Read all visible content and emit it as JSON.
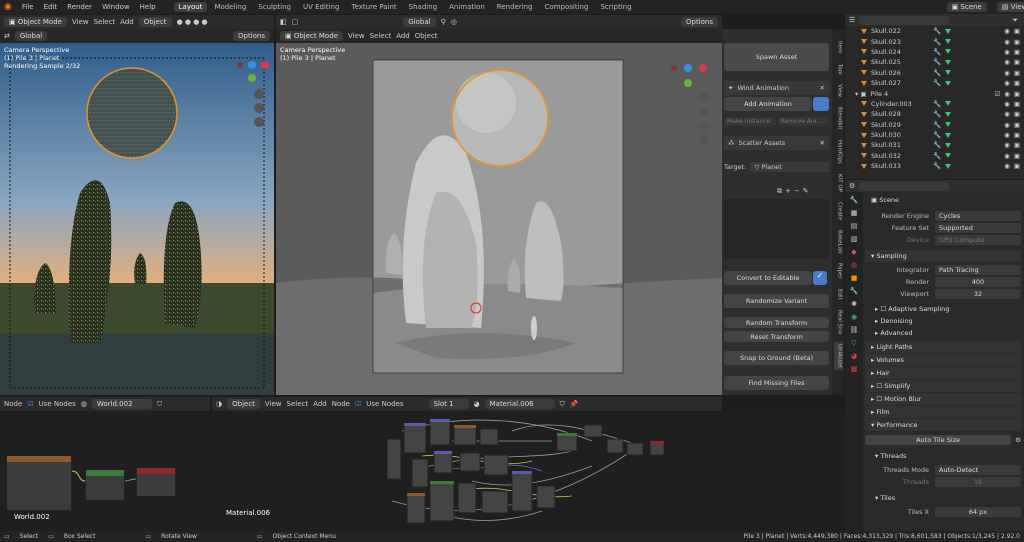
{
  "topbar": {
    "menus": [
      "File",
      "Edit",
      "Render",
      "Window",
      "Help"
    ],
    "tabs": [
      "Layout",
      "Modeling",
      "Sculpting",
      "UV Editing",
      "Texture Paint",
      "Shading",
      "Animation",
      "Rendering",
      "Compositing",
      "Scripting"
    ],
    "active_tab": "Layout",
    "scene": "Scene",
    "view_layer": "View Layer"
  },
  "left_view": {
    "mode": "Object Mode",
    "menus": [
      "View",
      "Select",
      "Add",
      "Object"
    ],
    "transform": "Global",
    "options": "Options",
    "label1": "Camera Perspective",
    "label2": "(1) Pile 3 | Planet",
    "label3": "Rendering Sample 2/32"
  },
  "main_view": {
    "mode": "Object Mode",
    "menus": [
      "View",
      "Select",
      "Add",
      "Object"
    ],
    "transform": "Global",
    "options": "Options",
    "label1": "Camera Perspective",
    "label2": "(1) Pile 3 | Planet"
  },
  "npanel": {
    "spawn": "Spawn Asset",
    "wind": "Wind Animation",
    "add_anim": "Add Animation",
    "make_inst": "Make Instance",
    "remove_anim": "Remove Ani...",
    "scatter": "Scatter Assets",
    "target_label": "Target:",
    "target": "Planet",
    "convert": "Convert to Editable",
    "randomize": "Randomize Variant",
    "random_tf": "Random Transform",
    "reset_tf": "Reset Transform",
    "snap": "Snap to Ground (Beta)",
    "find": "Find Missing Files",
    "tabs": [
      "Item",
      "Tool",
      "View",
      "Blendkit",
      "HardOps",
      "KIT OP",
      "Create",
      "BakeLab",
      "Paper",
      "Edit",
      "Real Sno",
      "UniAsset"
    ]
  },
  "outliner": {
    "rows": [
      {
        "name": "Skull.022",
        "type": "mesh"
      },
      {
        "name": "Skull.023",
        "type": "mesh"
      },
      {
        "name": "Skull.024",
        "type": "mesh"
      },
      {
        "name": "Skull.025",
        "type": "mesh"
      },
      {
        "name": "Skull.026",
        "type": "mesh"
      },
      {
        "name": "Skull.027",
        "type": "mesh"
      },
      {
        "name": "Pile 4",
        "type": "collection"
      },
      {
        "name": "Cylinder.003",
        "type": "mesh"
      },
      {
        "name": "Skull.028",
        "type": "mesh"
      },
      {
        "name": "Skull.029",
        "type": "mesh"
      },
      {
        "name": "Skull.030",
        "type": "mesh"
      },
      {
        "name": "Skull.031",
        "type": "mesh"
      },
      {
        "name": "Skull.032",
        "type": "mesh"
      },
      {
        "name": "Skull.033",
        "type": "mesh"
      }
    ]
  },
  "props": {
    "scene": "Scene",
    "render_engine_label": "Render Engine",
    "render_engine": "Cycles",
    "feature_set_label": "Feature Set",
    "feature_set": "Supported",
    "device_label": "Device",
    "device": "GPU Compute",
    "sampling": "Sampling",
    "integrator_label": "Integrator",
    "integrator": "Path Tracing",
    "render_label": "Render",
    "render": "400",
    "viewport_label": "Viewport",
    "viewport": "32",
    "adaptive": "Adaptive Sampling",
    "denoising": "Denoising",
    "advanced": "Advanced",
    "light_paths": "Light Paths",
    "volumes": "Volumes",
    "hair": "Hair",
    "simplify": "Simplify",
    "motion_blur": "Motion Blur",
    "film": "Film",
    "performance": "Performance",
    "auto_tile": "Auto Tile Size",
    "threads": "Threads",
    "threads_mode_label": "Threads Mode",
    "threads_mode": "Auto-Detect",
    "threads_count_label": "Threads",
    "threads_count": "16",
    "tiles": "Tiles",
    "tiles_x_label": "Tiles X",
    "tiles_x": "64 px"
  },
  "world_editor": {
    "menus": [
      "Node"
    ],
    "use_nodes": "Use Nodes",
    "world": "World.002",
    "label": "World.002"
  },
  "material_editor": {
    "type": "Object",
    "menus": [
      "View",
      "Select",
      "Add",
      "Node"
    ],
    "use_nodes": "Use Nodes",
    "slot": "Slot 1",
    "material": "Material.006",
    "label": "Material.006"
  },
  "status": {
    "select": "Select",
    "box_select": "Box Select",
    "rotate": "Rotate View",
    "context": "Object Context Menu",
    "stats": "Pile 3 | Planet | Verts:4,449,380 | Faces:4,313,329 | Tris:8,601,583 | Objects:1/3,245 | 2.92.0"
  }
}
